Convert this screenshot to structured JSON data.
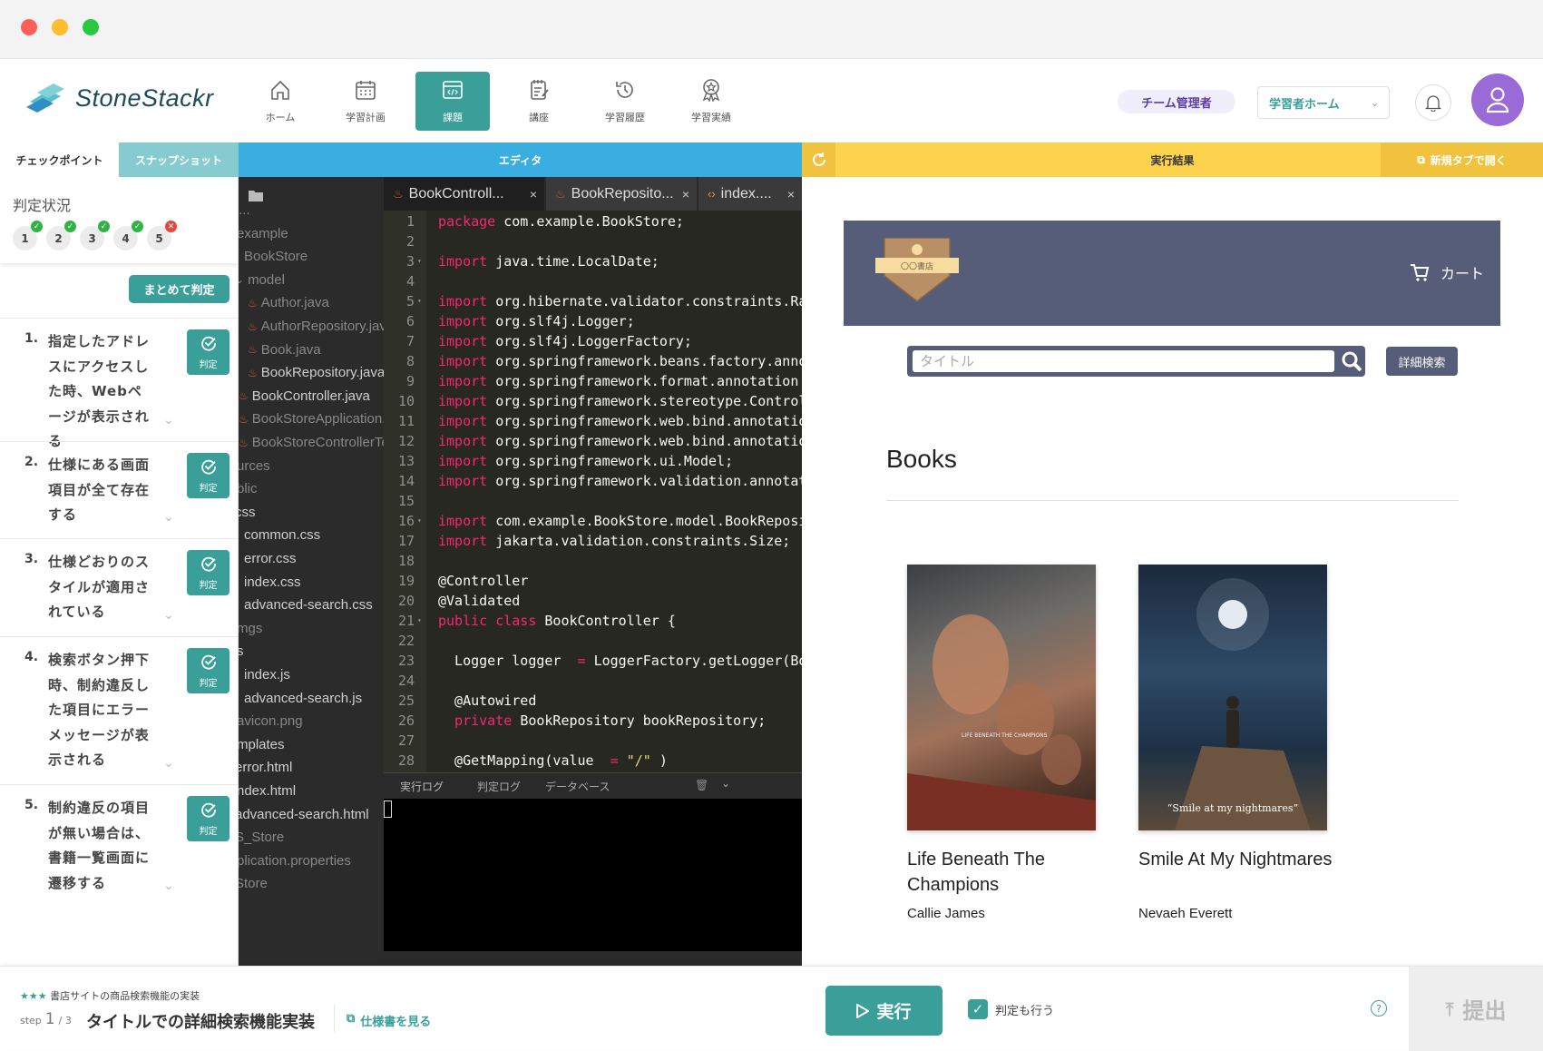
{
  "window": {
    "traffic_colors": [
      "#ff5f57",
      "#febc2e",
      "#28c840"
    ]
  },
  "header": {
    "logo_text": "StoneStackr",
    "nav": [
      {
        "label": "ホーム",
        "icon": "home-icon"
      },
      {
        "label": "学習計画",
        "icon": "calendar-icon"
      },
      {
        "label": "課題",
        "icon": "code-window-icon",
        "active": true
      },
      {
        "label": "講座",
        "icon": "notebook-icon"
      },
      {
        "label": "学習履歴",
        "icon": "history-icon"
      },
      {
        "label": "学習実績",
        "icon": "award-icon"
      }
    ],
    "role_badge": "チーム管理者",
    "home_select": "学習者ホーム",
    "accent": "#3a9f98"
  },
  "left": {
    "tabs": [
      "チェックポイント",
      "スナップショット"
    ],
    "status_title": "判定状況",
    "status": [
      {
        "n": "1",
        "ok": true
      },
      {
        "n": "2",
        "ok": true
      },
      {
        "n": "3",
        "ok": true
      },
      {
        "n": "4",
        "ok": true
      },
      {
        "n": "5",
        "ok": false
      }
    ],
    "judge_all": "まとめて判定",
    "judge_label": "判定",
    "items": [
      {
        "num": "1.",
        "text": "指定したアドレスにアクセスした時、Webページが表示される"
      },
      {
        "num": "2.",
        "text": "仕様にある画面項目が全て存在する"
      },
      {
        "num": "3.",
        "text": "仕様どおりのスタイルが適用されている"
      },
      {
        "num": "4.",
        "text": "検索ボタン押下時、制約違反した項目にエラーメッセージが表示される"
      },
      {
        "num": "5.",
        "text": "制約違反の項目が無い場合は、書籍一覧画面に遷移する"
      }
    ]
  },
  "editor": {
    "bar_title": "エディタ",
    "tree": [
      {
        "t": "...",
        "x": 0,
        "dim": true
      },
      {
        "t": "example",
        "x": -2,
        "dim": true
      },
      {
        "t": "BookStore",
        "x": 6,
        "dim": true
      },
      {
        "t": "model",
        "x": -4,
        "dim": true,
        "chev": true
      },
      {
        "t": "Author.java",
        "x": 10,
        "java": true,
        "dim": true
      },
      {
        "t": "AuthorRepository.java",
        "x": 10,
        "java": true,
        "dim": true
      },
      {
        "t": "Book.java",
        "x": 10,
        "java": true,
        "dim": true
      },
      {
        "t": "BookRepository.java",
        "x": 10,
        "java": true
      },
      {
        "t": "BookController.java",
        "x": 0,
        "java": true
      },
      {
        "t": "BookStoreApplication.java",
        "x": 0,
        "java": true,
        "dim": true
      },
      {
        "t": "BookStoreControllerTests.java",
        "x": 0,
        "java": true,
        "dim": true
      },
      {
        "t": "urces",
        "x": -2,
        "dim": true
      },
      {
        "t": "blic",
        "x": -2,
        "dim": true
      },
      {
        "t": "css",
        "x": -4
      },
      {
        "t": "common.css",
        "x": 6
      },
      {
        "t": "error.css",
        "x": 6
      },
      {
        "t": "index.css",
        "x": 6
      },
      {
        "t": "advanced-search.css",
        "x": 6
      },
      {
        "t": "mgs",
        "x": -2,
        "dim": true
      },
      {
        "t": "s",
        "x": -2
      },
      {
        "t": "index.js",
        "x": 6
      },
      {
        "t": "advanced-search.js",
        "x": 6
      },
      {
        "t": "avicon.png",
        "x": -2,
        "dim": true
      },
      {
        "t": "mplates",
        "x": -2
      },
      {
        "t": "error.html",
        "x": -4
      },
      {
        "t": "ndex.html",
        "x": -2
      },
      {
        "t": "advanced-search.html",
        "x": -4
      },
      {
        "t": "S_Store",
        "x": -4,
        "dim": true
      },
      {
        "t": "plication.properties",
        "x": -2,
        "dim": true
      },
      {
        "t": "Store",
        "x": -4,
        "dim": true
      }
    ],
    "tabs": [
      {
        "label": "BookControll...",
        "type": "java"
      },
      {
        "label": "BookReposito...",
        "type": "java"
      },
      {
        "label": "index....",
        "type": "html"
      }
    ],
    "lines": [
      [
        [
          "kw",
          "package"
        ],
        [
          "",
          "com.example.BookStore;"
        ]
      ],
      [],
      [
        [
          "kw",
          "import"
        ],
        [
          "",
          "java.time.LocalDate;"
        ]
      ],
      [],
      [
        [
          "kw",
          "import"
        ],
        [
          "",
          "org.hibernate.validator.constraints.Range;"
        ]
      ],
      [
        [
          "kw",
          "import"
        ],
        [
          "",
          "org.slf4j.Logger;"
        ]
      ],
      [
        [
          "kw",
          "import"
        ],
        [
          "",
          "org.slf4j.LoggerFactory;"
        ]
      ],
      [
        [
          "kw",
          "import"
        ],
        [
          "",
          "org.springframework.beans.factory.annotation.Autowired;"
        ]
      ],
      [
        [
          "kw",
          "import"
        ],
        [
          "",
          "org.springframework.format.annotation.DateTimeFormat;"
        ]
      ],
      [
        [
          "kw",
          "import"
        ],
        [
          "",
          "org.springframework.stereotype.Controller;"
        ]
      ],
      [
        [
          "kw",
          "import"
        ],
        [
          "",
          "org.springframework.web.bind.annotation.GetMapping;"
        ]
      ],
      [
        [
          "kw",
          "import"
        ],
        [
          "",
          "org.springframework.web.bind.annotation.RequestParam;"
        ]
      ],
      [
        [
          "kw",
          "import"
        ],
        [
          "",
          "org.springframework.ui.Model;"
        ]
      ],
      [
        [
          "kw",
          "import"
        ],
        [
          "",
          "org.springframework.validation.annotation.Validated;"
        ]
      ],
      [],
      [
        [
          "kw",
          "import"
        ],
        [
          "",
          "com.example.BookStore.model.BookRepository;"
        ]
      ],
      [
        [
          "kw",
          "import"
        ],
        [
          "",
          "jakarta.validation.constraints.Size;"
        ]
      ],
      [],
      [
        [
          "",
          "@Controller"
        ]
      ],
      [
        [
          "",
          "@Validated"
        ]
      ],
      [
        [
          "kw",
          "public"
        ],
        [
          "kw",
          "class"
        ],
        [
          "",
          "BookController {"
        ]
      ],
      [],
      [
        [
          "",
          "  Logger logger "
        ],
        [
          "kw",
          "="
        ],
        [
          "",
          "LoggerFactory.getLogger(BookController.class);"
        ]
      ],
      [],
      [
        [
          "",
          "  @Autowired"
        ]
      ],
      [
        [
          "kw",
          "  private"
        ],
        [
          "",
          "BookRepository bookRepository;"
        ]
      ],
      [],
      [
        [
          "",
          "  @GetMapping(value "
        ],
        [
          "kw",
          "="
        ],
        [
          "str",
          "\"/\""
        ],
        [
          "",
          ")"
        ]
      ]
    ],
    "fold_lines": [
      3,
      5,
      16,
      21
    ],
    "log_tabs": [
      "実行ログ",
      "判定ログ",
      "データベース"
    ]
  },
  "result": {
    "bar_title": "実行結果",
    "open_new_tab": "新規タブで開く",
    "site": {
      "logo_text": "〇〇書店",
      "cart": "カート",
      "search_placeholder": "タイトル",
      "advanced_search": "詳細検索",
      "heading": "Books",
      "books": [
        {
          "title": "Life Beneath The Champions",
          "author": "Callie James",
          "cover_text": "LIFE BENEATH THE CHAMPIONS"
        },
        {
          "title": "Smile At My Nightmares",
          "author": "Nevaeh Everett",
          "cover_text": "“Smile at my nightmares”"
        }
      ]
    },
    "bar_color": "#fdd34d"
  },
  "bottom": {
    "stars": "★★★",
    "course": "書店サイトの商品検索機能の実装",
    "step_prefix": "step",
    "step_current": "1",
    "step_total": "/ 3",
    "task_title": "タイトルでの詳細検索機能実装",
    "spec_link": "仕様書を見る",
    "run": "実行",
    "also_judge": "判定も行う",
    "also_judge_checked": true,
    "submit": "提出"
  }
}
